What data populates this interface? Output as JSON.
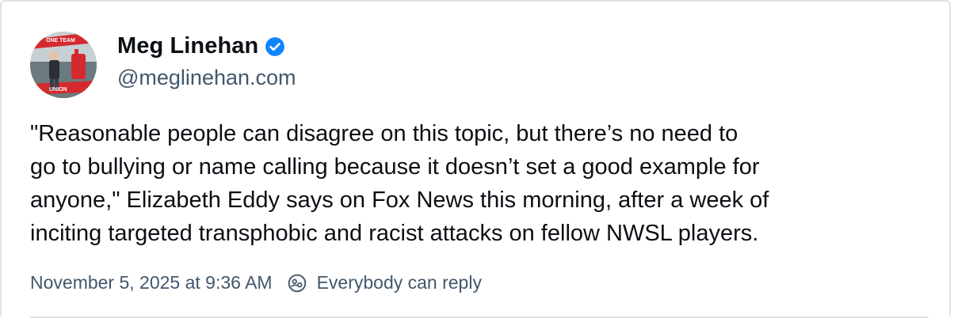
{
  "author": {
    "display_name": "Meg Linehan",
    "handle": "@meglinehan.com",
    "verified": true,
    "avatar_banner_text_top": "ONE TEAM",
    "avatar_banner_text_bottom": "UNION"
  },
  "post": {
    "text": "\"Reasonable people can disagree on this topic, but there’s no need to\ngo to bullying or name calling because it doesn’t set a good example for\nanyone,\" Elizabeth Eddy says on Fox News this morning, after a week of\ninciting targeted transphobic and racist attacks on fellow NWSL players."
  },
  "meta": {
    "timestamp": "November 5, 2025 at 9:36 AM",
    "reply_setting": "Everybody can reply"
  },
  "colors": {
    "verified_blue": "#1083fe",
    "muted_text": "#42576c",
    "divider": "#dfe3e8",
    "banner_red": "#d42a2f"
  },
  "icons": {
    "verified": "verified-badge-icon",
    "reply_setting": "everybody-reply-icon"
  }
}
